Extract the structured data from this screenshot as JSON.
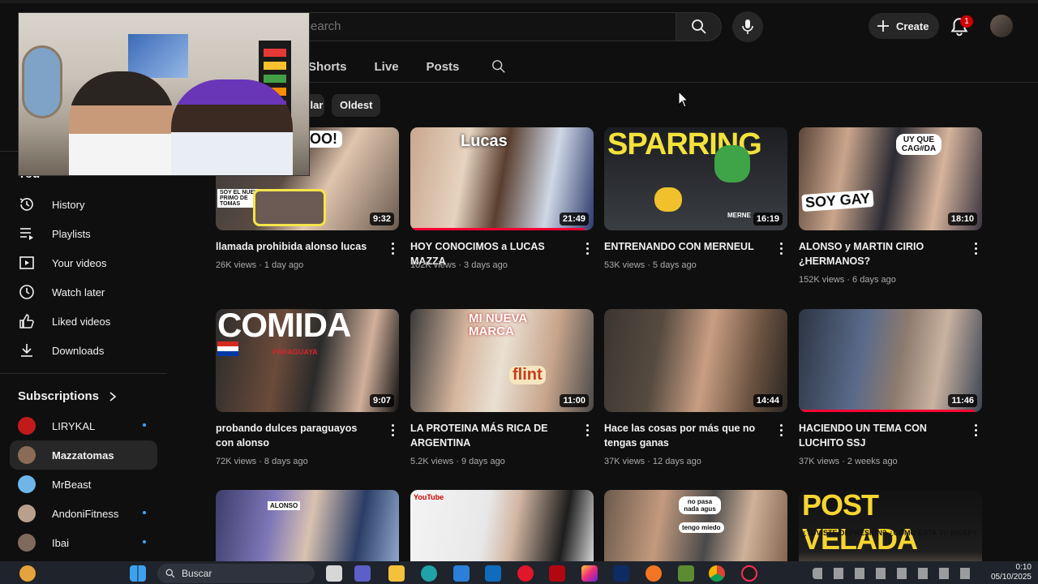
{
  "header": {
    "search_placeholder": "Search",
    "create_label": "Create",
    "notification_count": "1"
  },
  "channel_tabs": [
    "Shorts",
    "Live",
    "Posts"
  ],
  "filter_chips": {
    "popular": "Popular",
    "oldest": "Oldest"
  },
  "sidebar": {
    "you_label": "You",
    "items": [
      {
        "label": "History",
        "icon": "history-icon"
      },
      {
        "label": "Playlists",
        "icon": "playlists-icon"
      },
      {
        "label": "Your videos",
        "icon": "your-videos-icon"
      },
      {
        "label": "Watch later",
        "icon": "watch-later-icon"
      },
      {
        "label": "Liked videos",
        "icon": "thumbs-up-icon"
      },
      {
        "label": "Downloads",
        "icon": "download-icon"
      }
    ],
    "subscriptions_label": "Subscriptions",
    "subscriptions": [
      {
        "name": "LIRYKAL",
        "new": true
      },
      {
        "name": "Mazzatomas",
        "new": false,
        "active": true
      },
      {
        "name": "MrBeast",
        "new": false
      },
      {
        "name": "AndoniFitness",
        "new": true
      },
      {
        "name": "Ibai",
        "new": true
      }
    ]
  },
  "videos": [
    {
      "title": "llamada prohibida alonso lucas",
      "views": "26K views",
      "age": "1 day ago",
      "duration": "9:32",
      "thumb_text": "OO!",
      "thumb_sub": "SOY EL NUEVO PRIMO DE TOMAS"
    },
    {
      "title": "HOY CONOCIMOS a LUCAS MAZZA",
      "views": "102K views",
      "age": "3 days ago",
      "duration": "21:49",
      "thumb_text": "Lucas",
      "thumb_sub": ""
    },
    {
      "title": "ENTRENANDO CON MERNEUL",
      "views": "53K views",
      "age": "5 days ago",
      "duration": "16:19",
      "thumb_text": "SPARRING",
      "thumb_sub": "MERNE"
    },
    {
      "title": "ALONSO y MARTIN CIRIO ¿HERMANOS?",
      "views": "152K views",
      "age": "6 days ago",
      "duration": "18:10",
      "thumb_text": "SOY GAY",
      "thumb_sub": "UY QUE CAG#DA"
    },
    {
      "title": "probando dulces paraguayos con alonso",
      "views": "72K views",
      "age": "8 days ago",
      "duration": "9:07",
      "thumb_text": "COMIDA",
      "thumb_sub": "PARAGUAYA"
    },
    {
      "title": "LA PROTEINA MÁS RICA DE ARGENTINA",
      "views": "5.2K views",
      "age": "9 days ago",
      "duration": "11:00",
      "thumb_text": "MI NUEVA MARCA",
      "thumb_sub": "flint"
    },
    {
      "title": "Hace las cosas por más que no tengas ganas",
      "views": "37K views",
      "age": "12 days ago",
      "duration": "14:44",
      "thumb_text": "",
      "thumb_sub": ""
    },
    {
      "title": "HACIENDO UN TEMA CON LUCHITO SSJ",
      "views": "37K views",
      "age": "2 weeks ago",
      "duration": "11:46",
      "thumb_text": "",
      "thumb_sub": ""
    },
    {
      "title": "",
      "views": "",
      "age": "",
      "duration": "",
      "thumb_text": "ALONSO",
      "thumb_sub": ""
    },
    {
      "title": "",
      "views": "",
      "age": "",
      "duration": "",
      "thumb_text": "YouTube",
      "thumb_sub": ""
    },
    {
      "title": "",
      "views": "",
      "age": "",
      "duration": "",
      "thumb_text": "no pasa nada agus",
      "thumb_sub": "tengo miedo"
    },
    {
      "title": "",
      "views": "",
      "age": "",
      "duration": "",
      "thumb_text": "POST VELADA",
      "thumb_sub": "¿TUVISTE DEPRESIÓN? ¿CÓMO ESTA TU BICEP?"
    }
  ],
  "taskbar": {
    "search_label": "Buscar",
    "time": "0:10",
    "date": "05/10/2025"
  },
  "colors": {
    "accent_red": "#ff0033",
    "badge_red": "#cc0000",
    "dot_blue": "#3ea6ff"
  }
}
